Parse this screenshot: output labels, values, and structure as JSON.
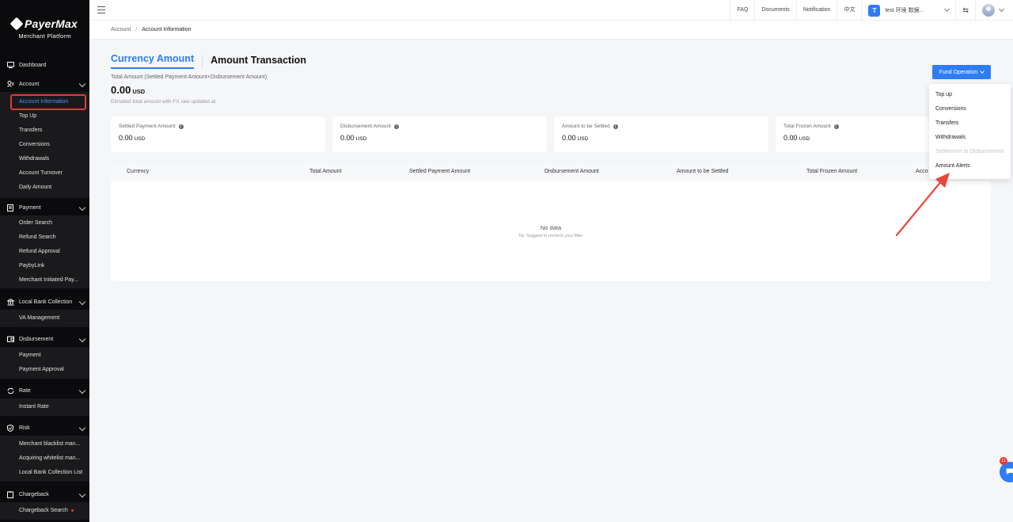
{
  "brand": {
    "name": "PayerMax",
    "subtitle": "Merchant  Platform"
  },
  "sidebar": {
    "dashboard": "Dashboard",
    "account": {
      "label": "Account",
      "items": [
        "Account Information",
        "Top Up",
        "Transfers",
        "Conversions",
        "Withdrawals",
        "Account Turnover",
        "Daily Amount"
      ]
    },
    "payment": {
      "label": "Payment",
      "items": [
        "Order Search",
        "Refund Search",
        "Refund Approval",
        "PaybyLink",
        "Merchant Initiated Pay..."
      ]
    },
    "local_bank": {
      "label": "Local Bank Collection",
      "items": [
        "VA Management"
      ]
    },
    "disbursement": {
      "label": "Disbursement",
      "items": [
        "Payment",
        "Payment Approval"
      ]
    },
    "rate": {
      "label": "Rate",
      "items": [
        "Instant Rate"
      ]
    },
    "risk": {
      "label": "Risk",
      "items": [
        "Merchant blacklist man...",
        "Acquiring whitelist man...",
        "Local Bank Collection List"
      ]
    },
    "chargeback": {
      "label": "Chargeback",
      "items": [
        "Chargeback Search"
      ]
    }
  },
  "header": {
    "links": [
      "FAQ",
      "Documents",
      "Notification",
      "中文"
    ],
    "user_initial": "T",
    "user_name": "test 环境 数据...",
    "swap_icon": "⇆"
  },
  "breadcrumb": {
    "parent": "Account",
    "current": "Account Information"
  },
  "tabs": {
    "active": "Currency Amount",
    "inactive": "Amount Transaction"
  },
  "summary": {
    "label": "Total Amount (Settled Payment Amount+Disbursement Amount)",
    "value": "0.00",
    "unit": "USD",
    "note": "Etimated total amount with FX rate updated at"
  },
  "fund_button": "Fund Operation",
  "cards": [
    {
      "label": "Settled Payment Amount",
      "value": "0.00",
      "unit": "USD"
    },
    {
      "label": "Disbursement Amount",
      "value": "0.00",
      "unit": "USD"
    },
    {
      "label": "Amount to be Settled",
      "value": "0.00",
      "unit": "USD"
    },
    {
      "label": "Total Frozen Amount",
      "value": "0.00",
      "unit": "USD"
    }
  ],
  "table": {
    "columns": [
      "Currency",
      "Total Amount",
      "Settled Payment Amount",
      "Disbursement Amount",
      "Amount to be Settled",
      "Total Frozen Amount",
      "Acco"
    ],
    "empty_title": "No data",
    "empty_tip": "Tip: Suggest to recheck your filter."
  },
  "dropdown": {
    "items": [
      "Top up",
      "Conversions",
      "Transfers",
      "Withdrawals",
      "Settlement to Disbursement",
      "Amount Alerts"
    ]
  },
  "chat": {
    "badge": "11"
  },
  "colors": {
    "accent": "#2e7cf6",
    "sidebar_bg": "#0b0b0d",
    "highlight": "#e03a3a"
  }
}
